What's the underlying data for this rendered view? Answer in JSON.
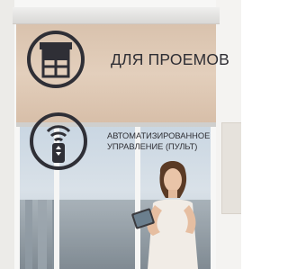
{
  "features": {
    "openings_label": "ДЛЯ ПРОЕМОВ",
    "automation_label_line1": "АВТОМАТИЗИРОВАННОЕ",
    "automation_label_line2": "УПРАВЛЕНИЕ (ПУЛЬТ)"
  },
  "icons": {
    "blind": "roller-blind-icon",
    "remote": "remote-control-icon"
  },
  "colors": {
    "icon_stroke": "#2f2f36",
    "text": "#2e2e34",
    "blind_fabric": "#dcc5b0",
    "frame": "#f7f7f6"
  }
}
